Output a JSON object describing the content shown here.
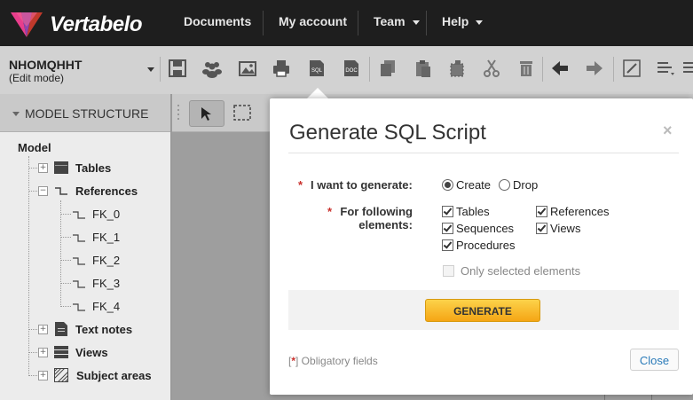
{
  "brand": {
    "name": "Vertabelo"
  },
  "nav": {
    "documents": "Documents",
    "my_account": "My account",
    "team": "Team",
    "help": "Help"
  },
  "model": {
    "name": "NHOMQHHT",
    "mode": "(Edit mode)"
  },
  "toolbar_icons": [
    "save-icon",
    "users-icon",
    "image-icon",
    "print-icon",
    "sql-icon",
    "doc-icon",
    "copy-icon",
    "paste-icon",
    "cut-shape-icon",
    "scissors-icon",
    "trash-icon",
    "undo-arrow-icon",
    "redo-arrow-icon",
    "edit-box-icon",
    "align-icon"
  ],
  "toolbar_icon_text": {
    "sql": "SQL",
    "doc": "DOC"
  },
  "sidebar": {
    "header": "MODEL STRUCTURE",
    "root": "Model",
    "items": [
      {
        "label": "Tables",
        "icon": "table-icon"
      },
      {
        "label": "References",
        "icon": "reference-icon"
      },
      {
        "label": "Text notes",
        "icon": "note-icon"
      },
      {
        "label": "Views",
        "icon": "view-icon"
      },
      {
        "label": "Subject areas",
        "icon": "area-icon"
      }
    ],
    "references": [
      "FK_0",
      "FK_1",
      "FK_2",
      "FK_3",
      "FK_4"
    ],
    "expander_plus": "+",
    "expander_minus": "−"
  },
  "dialog": {
    "title": "Generate SQL Script",
    "close_glyph": "×",
    "required_star": "*",
    "generate_label": "I want to generate:",
    "options": {
      "create": "Create",
      "drop": "Drop"
    },
    "selected_option": "Create",
    "elements_label_1": "For following",
    "elements_label_2": "elements:",
    "elements": {
      "tables": "Tables",
      "references": "References",
      "sequences": "Sequences",
      "views": "Views",
      "procedures": "Procedures"
    },
    "only_selected": "Only selected elements",
    "generate_button": "GENERATE",
    "obligatory_open": "[",
    "obligatory_close": "] Obligatory fields",
    "close_button": "Close"
  },
  "colors": {
    "accent": "#f5a515",
    "link": "#2b7bb9",
    "required": "#c9302c",
    "topbar": "#1e1e1e"
  }
}
